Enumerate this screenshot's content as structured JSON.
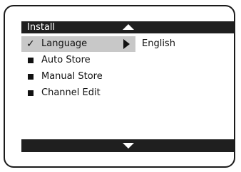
{
  "header": {
    "title": "Install"
  },
  "menu": {
    "items": [
      {
        "label": "Language",
        "icon": "check-icon",
        "selected": true
      },
      {
        "label": "Auto Store",
        "icon": "square-bullet-icon",
        "selected": false
      },
      {
        "label": "Manual Store",
        "icon": "square-bullet-icon",
        "selected": false
      },
      {
        "label": "Channel Edit",
        "icon": "square-bullet-icon",
        "selected": false
      }
    ]
  },
  "submenu": {
    "value": "English"
  },
  "colors": {
    "bar": "#1f1f1f",
    "highlight": "#c8c8c8",
    "text": "#111111"
  }
}
